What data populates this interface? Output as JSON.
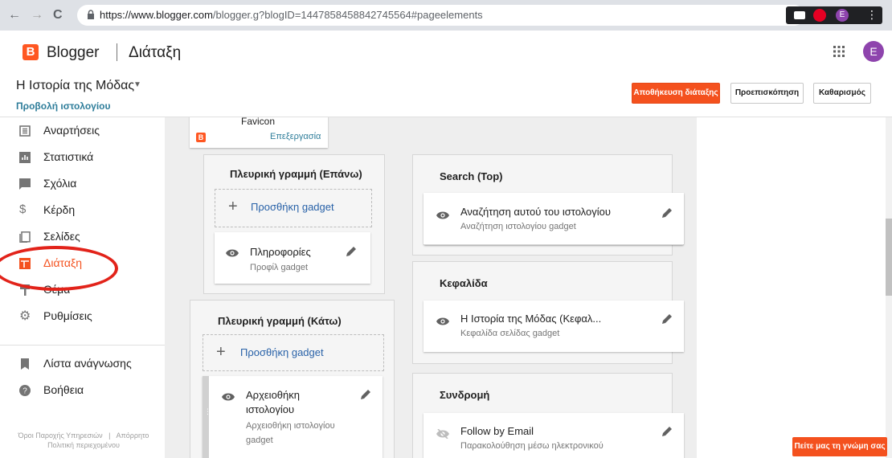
{
  "browser": {
    "url_host": "https://www.blogger.com",
    "url_path": "/blogger.g?blogID=1447858458842745564#pageelements",
    "nav_back": "←",
    "nav_forward": "→",
    "nav_reload": "C",
    "star": "☆",
    "ext_avatar": "E"
  },
  "app": {
    "logo_letter": "B",
    "name": "Blogger",
    "section": "Διάταξη",
    "avatar_letter": "E"
  },
  "blog": {
    "title": "Η Ιστορία της Μόδας",
    "view_link": "Προβολή ιστολογίου"
  },
  "actions": {
    "save": "Αποθήκευση διάταξης",
    "preview": "Προεπισκόπηση",
    "clear": "Καθαρισμός"
  },
  "sidebar": {
    "items": [
      {
        "label": "Αναρτήσεις",
        "icon": "posts-icon"
      },
      {
        "label": "Στατιστικά",
        "icon": "stats-icon"
      },
      {
        "label": "Σχόλια",
        "icon": "comments-icon"
      },
      {
        "label": "Κέρδη",
        "icon": "dollar-icon"
      },
      {
        "label": "Σελίδες",
        "icon": "pages-icon"
      },
      {
        "label": "Διάταξη",
        "icon": "layout-icon"
      },
      {
        "label": "Θέμα",
        "icon": "theme-icon"
      },
      {
        "label": "Ρυθμίσεις",
        "icon": "gear-icon"
      },
      {
        "label": "Λίστα ανάγνωσης",
        "icon": "bookmark-icon"
      },
      {
        "label": "Βοήθεια",
        "icon": "help-icon"
      }
    ],
    "footer_terms": "Όροι Παροχής Υπηρεσιών",
    "footer_privacy": "Απόρρητο",
    "footer_policy": "Πολιτική περιεχομένου",
    "footer_sep": "|"
  },
  "layout": {
    "favicon": {
      "title": "Favicon",
      "edit": "Επεξεργασία"
    },
    "sidebar_top": {
      "title": "Πλευρική γραμμή (Επάνω)",
      "add": "Προσθήκη gadget",
      "gadget_title": "Πληροφορίες",
      "gadget_sub": "Προφίλ gadget"
    },
    "sidebar_bottom": {
      "title": "Πλευρική γραμμή (Κάτω)",
      "add": "Προσθήκη gadget",
      "gadget_title_1": "Αρχειοθήκη",
      "gadget_title_2": "ιστολογίου",
      "gadget_sub_1": "Αρχειοθήκη ιστολογίου",
      "gadget_sub_2": "gadget"
    },
    "search_top": {
      "title": "Search (Top)",
      "gadget_title": "Αναζήτηση αυτού του ιστολογίου",
      "gadget_sub": "Αναζήτηση ιστολογίου gadget"
    },
    "header": {
      "title": "Κεφαλίδα",
      "gadget_title": "Η Ιστορία της Μόδας (Κεφαλ...",
      "gadget_sub": "Κεφαλίδα σελίδας gadget"
    },
    "subscribe": {
      "title": "Συνδρομή",
      "gadget_title": "Follow by Email",
      "gadget_sub": "Παρακολούθηση μέσω ηλεκτρονικού"
    }
  },
  "feedback": "Πείτε μας τη γνώμη σας",
  "colors": {
    "accent": "#f4511e",
    "link": "#2962a8",
    "annotation": "#e2231a"
  }
}
